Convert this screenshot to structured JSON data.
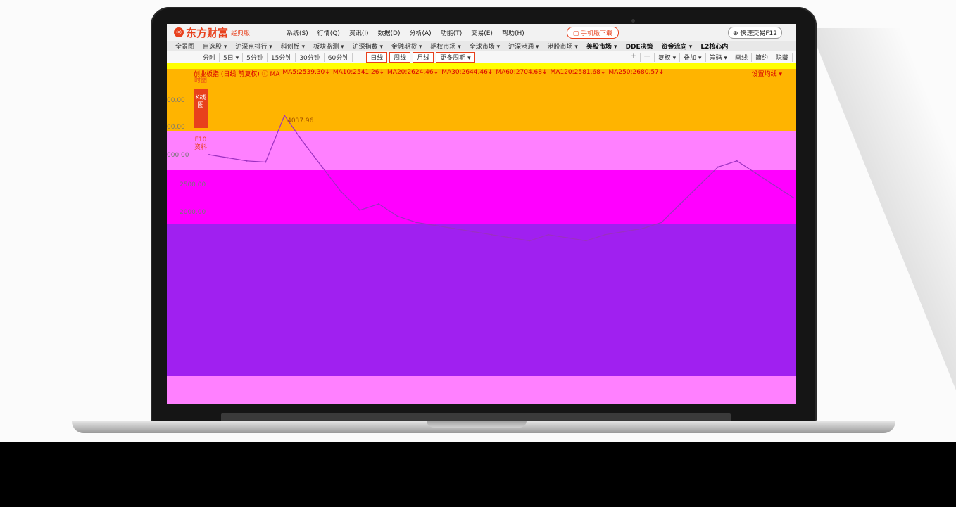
{
  "app": {
    "brand": "东方财富",
    "edition": "经典版",
    "menu": [
      "系统(S)",
      "行情(Q)",
      "资讯(I)",
      "数据(D)",
      "分析(A)",
      "功能(T)",
      "交易(E)",
      "帮助(H)"
    ],
    "mobile_download": "手机版下载",
    "quick_trade": "快速交易F12"
  },
  "navbar": {
    "items": [
      "全景图",
      "自选股 ▾",
      "沪深京排行 ▾",
      "科创板 ▾",
      "板块监测 ▾",
      "沪深指数 ▾",
      "金融期货 ▾",
      "期权市场 ▾",
      "全球市场 ▾",
      "沪深港通 ▾",
      "港股市场 ▾"
    ],
    "dark_items": [
      "美股市场 ▾",
      "DDE决策",
      "资金流向 ▾",
      "L2核心内"
    ]
  },
  "toolbar": {
    "periods": [
      "分时",
      "5日 ▾",
      "5分钟",
      "15分钟",
      "30分钟",
      "60分钟"
    ],
    "tabs": [
      "日线",
      "周线",
      "月线",
      "更多周期 ▾"
    ],
    "tools": [
      "+",
      "—",
      "复权 ▾",
      "叠加 ▾",
      "筹码 ▾",
      "画线",
      "简约",
      "隐藏"
    ]
  },
  "ma_bar": {
    "title": "创业板指 (日线 前复权) ⓘ MA",
    "items": [
      "MA5:2539.30↓",
      "MA10:2541.26↓",
      "MA20:2624.46↓",
      "MA30:2644.46↓",
      "MA60:2704.68↓",
      "MA120:2581.68↓",
      "MA250:2680.57↓"
    ],
    "settings": "设置均线 ▾"
  },
  "side_tabs": {
    "chart_tab_top": "时图",
    "kline": "K线图",
    "f10": "F10资料"
  },
  "axis_labels": [
    "00.00",
    "00.00",
    "000.00",
    "2500.00",
    "2000.00"
  ],
  "peak_label": "4037.96",
  "chart_data": {
    "type": "line",
    "title": "创业板指 (日线 前复权)",
    "series": [
      {
        "name": "创业板指",
        "values": [
          3400,
          3350,
          3300,
          3280,
          4037.96,
          3600,
          3200,
          2800,
          2500,
          2600,
          2400,
          2300,
          2250,
          2200,
          2150,
          2100,
          2050,
          2000,
          2100,
          2050,
          2000,
          2100,
          2150,
          2200,
          2300,
          2600,
          2900,
          3200,
          3300,
          3100,
          2900,
          2700
        ]
      }
    ],
    "ylim": [
      1800,
      4200
    ]
  },
  "colors": {
    "brand": "#e8401c",
    "ma_text": "#d90000",
    "line": "#9b30c0"
  }
}
